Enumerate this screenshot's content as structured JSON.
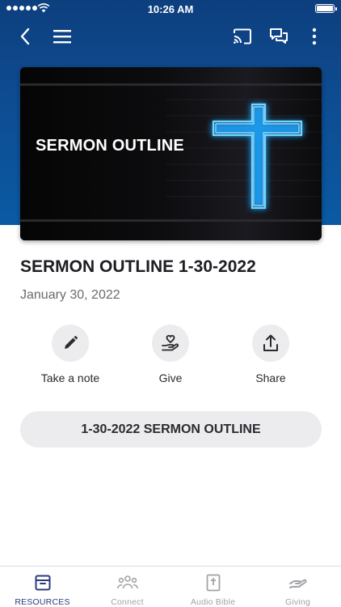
{
  "status_bar": {
    "time": "10:26 AM"
  },
  "colors": {
    "header": "#0e4c92",
    "accent": "#2c3a7a",
    "cross_glow": "#22b8ff"
  },
  "navbar": {
    "icons": [
      "back-chevron-icon",
      "menu-icon",
      "cast-icon",
      "chat-icon",
      "more-vertical-icon"
    ]
  },
  "hero": {
    "image_text": "SERMON OUTLINE"
  },
  "sermon": {
    "title": "SERMON OUTLINE 1-30-2022",
    "date": "January 30, 2022"
  },
  "actions": [
    {
      "label": "Take a note",
      "icon": "pencil-icon"
    },
    {
      "label": "Give",
      "icon": "heart-hand-icon"
    },
    {
      "label": "Share",
      "icon": "share-icon"
    }
  ],
  "outline_button": {
    "label": "1-30-2022 SERMON OUTLINE"
  },
  "tabbar": {
    "tabs": [
      {
        "label": "RESOURCES",
        "icon": "archive-box-icon",
        "active": true
      },
      {
        "label": "Connect",
        "icon": "people-icon",
        "active": false
      },
      {
        "label": "Audio Bible",
        "icon": "bible-icon",
        "active": false
      },
      {
        "label": "Giving",
        "icon": "giving-hand-icon",
        "active": false
      }
    ]
  }
}
